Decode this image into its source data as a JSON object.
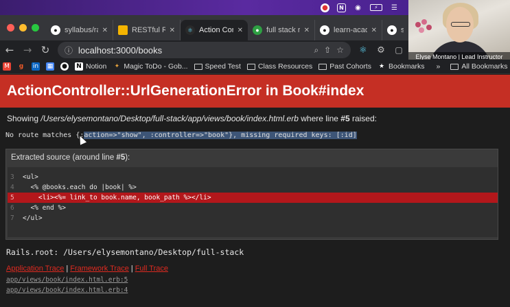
{
  "menubar": {
    "icons": [
      "chrome-icon",
      "notion-icon",
      "airdrop-icon",
      "battery-icon",
      "wifi-icon"
    ],
    "notion_letter": "N"
  },
  "tabs": [
    {
      "title": "syllabus/ra",
      "favicon": "github-icon",
      "active": false
    },
    {
      "title": "RESTful Ro",
      "favicon": "slides-icon",
      "active": false
    },
    {
      "title": "Action Con",
      "favicon": "react-icon",
      "active": true
    },
    {
      "title": "full stack r",
      "favicon": "github-icon",
      "active": false
    },
    {
      "title": "learn-acad",
      "favicon": "github-icon",
      "active": false
    },
    {
      "title": "sy",
      "favicon": "github-icon",
      "active": false
    }
  ],
  "toolbar": {
    "url": "localhost:3000/books"
  },
  "bookmarks": [
    {
      "label": "",
      "icon": "gmail-icon"
    },
    {
      "label": "",
      "icon": "g-icon"
    },
    {
      "label": "",
      "icon": "linkedin-icon"
    },
    {
      "label": "",
      "icon": "calendar-icon"
    },
    {
      "label": "",
      "icon": "github-icon"
    },
    {
      "label": "Notion",
      "icon": "notion-icon"
    },
    {
      "label": "Magic ToDo - Gob...",
      "icon": "magic-icon"
    },
    {
      "label": "Speed Test",
      "icon": "folder-icon"
    },
    {
      "label": "Class Resources",
      "icon": "folder-icon"
    },
    {
      "label": "Past Cohorts",
      "icon": "folder-icon"
    },
    {
      "label": "Bookmarks",
      "icon": "star-icon"
    }
  ],
  "bookmarks_overflow": "»",
  "all_bookmarks": "All Bookmarks",
  "webcam": {
    "caption": "Elyse Montano | Lead Instructor"
  },
  "error": {
    "title": "ActionController::UrlGenerationError in Book#index",
    "raised_prefix": "Showing ",
    "raised_path": "/Users/elysemontano/Desktop/full-stack/app/views/book/index.html.erb",
    "raised_middle": " where line ",
    "raised_line": "#5",
    "raised_suffix": " raised:",
    "no_route_prefix": "No route matches {:",
    "no_route_selected": "action=>\"show\", :controller=>\"book\"}, missing required keys: [:id]",
    "source_title_prefix": "Extracted source (around line ",
    "source_title_line": "#5",
    "source_title_suffix": "):",
    "code_lines": [
      {
        "num": "3",
        "text": "<ul>",
        "highlight": false
      },
      {
        "num": "4",
        "text": "  <% @books.each do |book| %>",
        "highlight": false
      },
      {
        "num": "5",
        "text": "    <li><%= link_to book.name, book_path %></li>",
        "highlight": true
      },
      {
        "num": "6",
        "text": "  <% end %>",
        "highlight": false
      },
      {
        "num": "7",
        "text": "</ul>",
        "highlight": false
      }
    ],
    "rails_root": "Rails.root: /Users/elysemontano/Desktop/full-stack",
    "trace_links": [
      "Application Trace",
      "Framework Trace",
      "Full Trace"
    ],
    "trace_separator": "|",
    "trace_items": [
      "app/views/book/index.html.erb:5",
      "app/views/book/index.html.erb:4"
    ]
  },
  "colors": {
    "error_red": "#c52f24",
    "highlight_red": "#b3171b",
    "link_red": "#e02a20"
  }
}
